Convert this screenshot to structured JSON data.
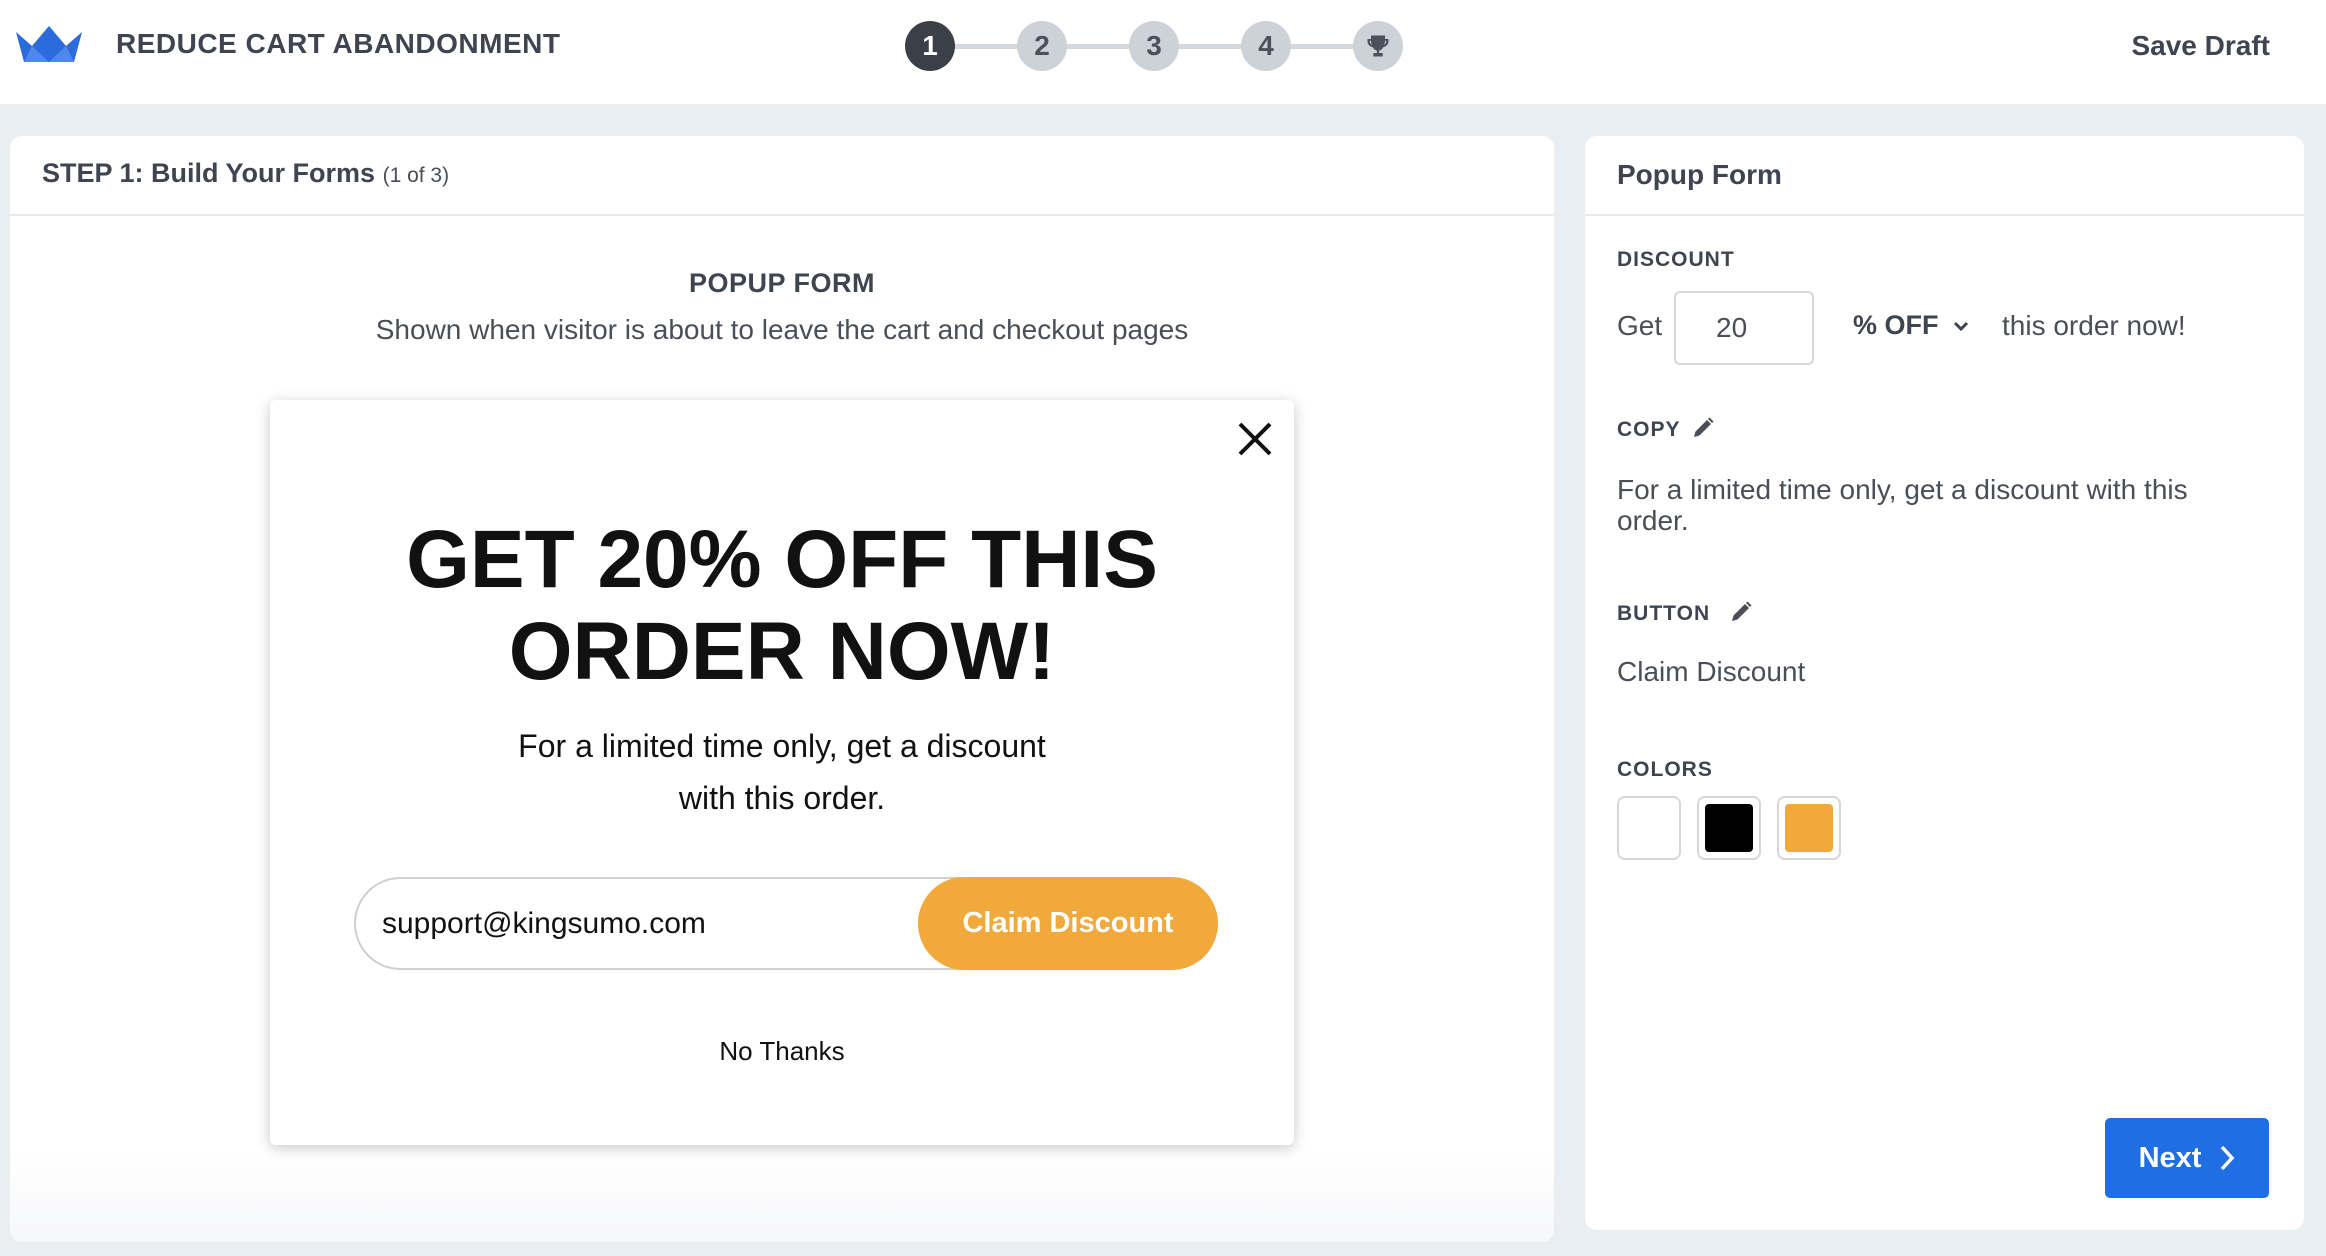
{
  "header": {
    "logo": "crown-icon",
    "title": "REDUCE CART ABANDONMENT",
    "steps": [
      "1",
      "2",
      "3",
      "4"
    ],
    "final_step_icon": "trophy-icon",
    "active_step": 1,
    "save_label": "Save Draft"
  },
  "main": {
    "step_title": "STEP 1: Build Your Forms",
    "step_sub": "(1 of 3)",
    "form_title": "POPUP FORM",
    "form_desc": "Shown when visitor is about to leave the cart and checkout pages"
  },
  "popup": {
    "headline_line1": "GET 20% OFF THIS",
    "headline_line2": "ORDER NOW!",
    "copy": "For a limited time only, get a discount with this order.",
    "email_value": "support@kingsumo.com",
    "button_label": "Claim Discount",
    "no_thanks": "No Thanks",
    "button_color": "#f2a93b"
  },
  "side": {
    "title": "Popup Form",
    "discount_label": "DISCOUNT",
    "get_text": "Get",
    "discount_value": "20",
    "discount_type": "% OFF",
    "after_text": "this order now!",
    "copy_label": "COPY",
    "copy_text": "For a limited time only, get a discount with this order.",
    "button_label": "BUTTON",
    "button_text": "Claim Discount",
    "colors_label": "COLORS",
    "colors": [
      "#ffffff",
      "#000000",
      "#f2a93b"
    ],
    "next_label": "Next",
    "accent": "#1f6ee4"
  }
}
